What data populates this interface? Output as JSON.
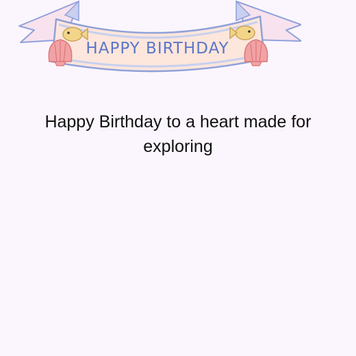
{
  "banner": {
    "text": "HAPPY BIRTHDAY",
    "colors": {
      "ribbon": "#fde6dc",
      "outline": "#8fa1d9",
      "text": "#5b76c9",
      "shell": "#f2a2a4",
      "fish": "#f3d58a"
    }
  },
  "message": {
    "text": "Happy Birthday to a heart made for exploring"
  },
  "background_color": "#fbf5fd"
}
